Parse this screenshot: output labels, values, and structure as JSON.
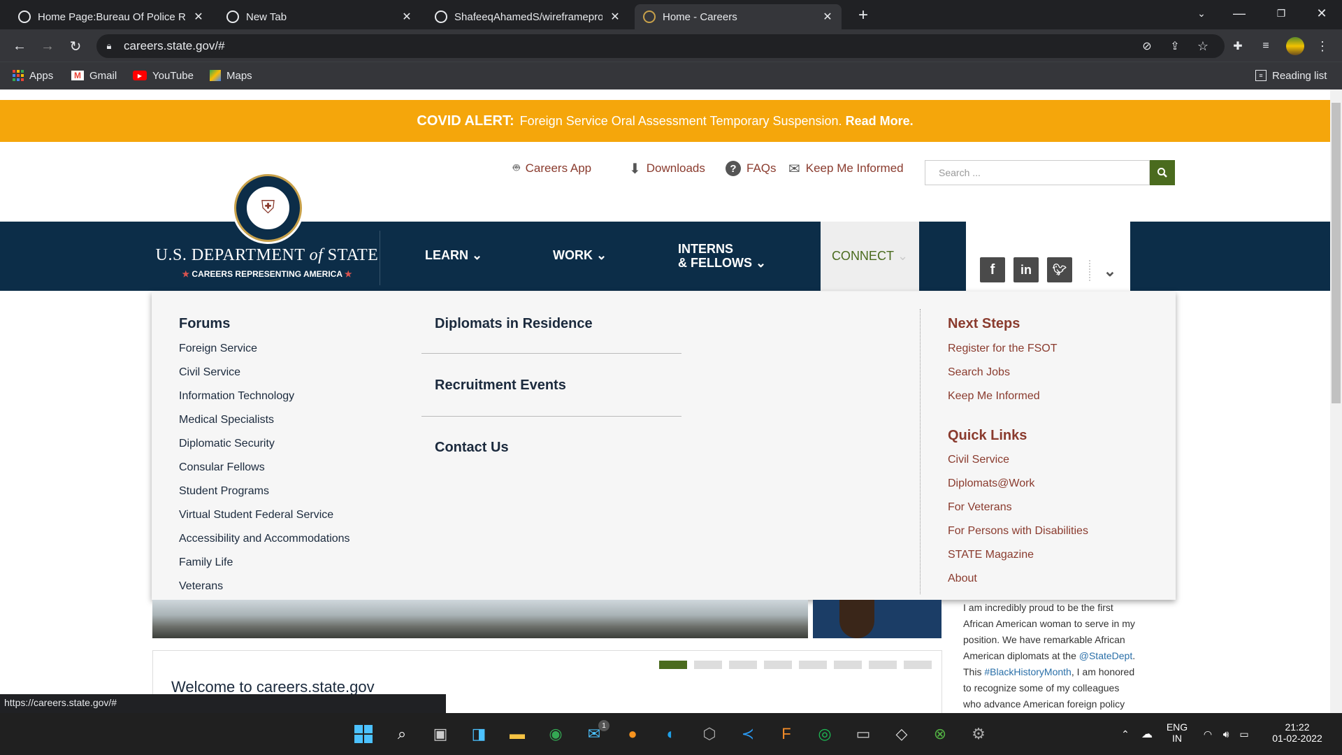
{
  "browser": {
    "tabs": [
      {
        "title": "Home Page:Bureau Of Police Res",
        "active": false
      },
      {
        "title": "New Tab",
        "active": false
      },
      {
        "title": "ShafeeqAhamedS/wireframeproj",
        "active": false
      },
      {
        "title": "Home - Careers",
        "active": true
      }
    ],
    "new_tab_symbol": "+",
    "url": "careers.state.gov/#",
    "reading_list": "Reading list",
    "bookmarks": [
      {
        "label": "Apps",
        "icon": "apps-grid-icon"
      },
      {
        "label": "Gmail",
        "icon": "gmail-icon"
      },
      {
        "label": "YouTube",
        "icon": "youtube-icon"
      },
      {
        "label": "Maps",
        "icon": "maps-icon"
      }
    ]
  },
  "alert": {
    "label": "COVID ALERT:",
    "text": "Foreign Service Oral Assessment Temporary Suspension.",
    "link": "Read More.",
    "color": "#f5a60b"
  },
  "utility": {
    "careers_app": "Careers App",
    "downloads": "Downloads",
    "faqs": "FAQs",
    "keep_informed": "Keep Me Informed",
    "search_placeholder": "Search ..."
  },
  "brand": {
    "name_a": "U.S. DEPARTMENT",
    "name_of": "of",
    "name_b": "STATE",
    "tagline": "CAREERS REPRESENTING AMERICA",
    "navy": "#0c2d48"
  },
  "nav": {
    "learn": "LEARN",
    "work": "WORK",
    "interns_1": "INTERNS",
    "interns_2": "& FELLOWS",
    "connect": "CONNECT"
  },
  "dropdown": {
    "forums_title": "Forums",
    "forums": [
      "Foreign Service",
      "Civil Service",
      "Information Technology",
      "Medical Specialists",
      "Diplomatic Security",
      "Consular Fellows",
      "Student Programs",
      "Virtual Student Federal Service",
      "Accessibility and Accommodations",
      "Family Life",
      "Veterans"
    ],
    "middle": [
      "Diplomats in Residence",
      "Recruitment Events",
      "Contact Us"
    ],
    "next_steps_title": "Next Steps",
    "next_steps": [
      "Register for the FSOT",
      "Search Jobs",
      "Keep Me Informed"
    ],
    "quick_links_title": "Quick Links",
    "quick_links": [
      "Civil Service",
      "Diplomats@Work",
      "For Veterans",
      "For Persons with Disabilities",
      "STATE Magazine",
      "About"
    ]
  },
  "sidebar_quote": {
    "l1": "I am incredibly proud to be the first",
    "l2": "African American woman to serve in my",
    "l3": "position. We have remarkable African",
    "l4a": "American diplomats at the ",
    "l4b": "@StateDept",
    "l4c": ".",
    "l5a": "This ",
    "l5b": "#BlackHistoryMonth",
    "l5c": ", I am honored",
    "l6": "to recognize some of my colleagues",
    "l7": "who advance American foreign policy"
  },
  "welcome": "Welcome to careers.state.gov",
  "carousel": {
    "count": 8,
    "active": 0
  },
  "status_url": "https://careers.state.gov/#",
  "taskbar": {
    "lang": "ENG",
    "region": "IN",
    "time": "21:22",
    "date": "01-02-2022",
    "mail_badge": "1"
  }
}
